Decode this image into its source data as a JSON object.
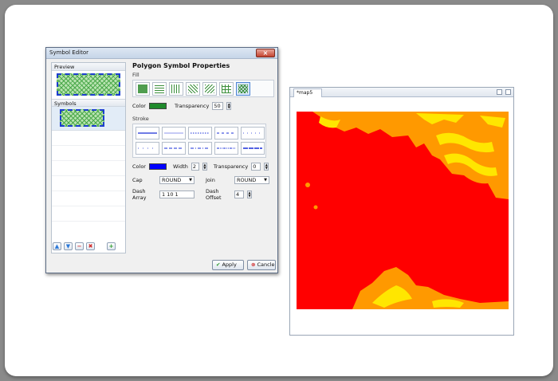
{
  "dialog": {
    "title": "Symbol Editor",
    "close_glyph": "×",
    "preview_label": "Preview",
    "symbols_label": "Symbols",
    "tools": [
      {
        "name": "move-up-icon",
        "glyph": "▲",
        "color": "#2a78d8"
      },
      {
        "name": "move-down-icon",
        "glyph": "▼",
        "color": "#2a78d8"
      },
      {
        "name": "remove-icon",
        "glyph": "−",
        "color": "#d02a2a"
      },
      {
        "name": "delete-icon",
        "glyph": "✖",
        "color": "#d02a2a"
      },
      {
        "name": "add-icon",
        "glyph": "+",
        "color": "#2a9a2a"
      }
    ],
    "properties_title": "Polygon Symbol Properties",
    "fill": {
      "label": "Fill",
      "color_label": "Color",
      "color": "#1f8a2b",
      "transparency_label": "Transparency",
      "transparency": "50"
    },
    "stroke": {
      "label": "Stroke",
      "color_label": "Color",
      "color": "#0000ff",
      "width_label": "Width",
      "width": "2",
      "transparency_label": "Transparency",
      "transparency": "0",
      "cap_label": "Cap",
      "cap": "ROUND",
      "join_label": "Join",
      "join": "ROUND",
      "dash_array_label": "Dash Array",
      "dash_array": "1 10 1",
      "dash_offset_label": "Dash Offset",
      "dash_offset": "4"
    },
    "apply_label": "Apply",
    "cancel_label": "Cancle"
  },
  "map": {
    "tab_label": "*map5",
    "colors": {
      "red": "#ff0000",
      "orange": "#ff9900",
      "yellow": "#ffe600"
    }
  }
}
